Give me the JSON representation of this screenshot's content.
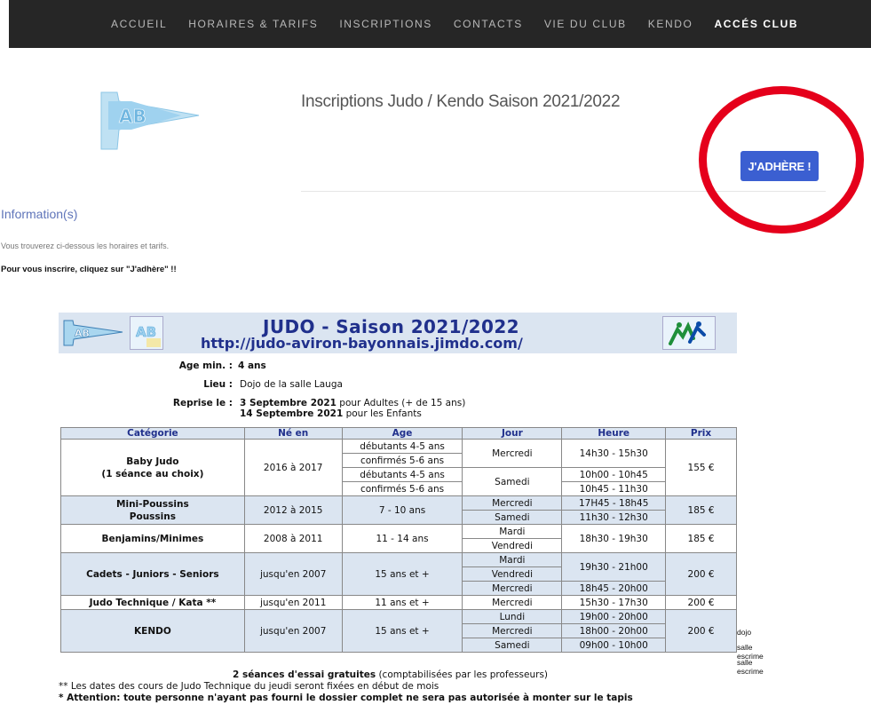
{
  "nav": {
    "items": [
      "ACCUEIL",
      "HORAIRES & TARIFS",
      "INSCRIPTIONS",
      "CONTACTS",
      "VIE DU CLUB",
      "KENDO",
      "ACCÉS CLUB"
    ],
    "active": "ACCÉS CLUB"
  },
  "logo": {
    "text": "AB"
  },
  "page_title": "Inscriptions Judo / Kendo Saison 2021/2022",
  "join_button": "J'ADHÈRE !",
  "info": {
    "heading": "Information(s)",
    "text": "Vous trouverez ci-dessous les horaires et tarifs.",
    "bold": "Pour vous inscrire, cliquez sur \"J'adhère\" !!"
  },
  "poster": {
    "title": "JUDO - Saison 2021/2022",
    "url": "http://judo-aviron-bayonnais.jimdo.com/",
    "age_label": "Age min. :",
    "age_value": "4 ans",
    "place_label": "Lieu :",
    "place_value": "Dojo de la salle Lauga",
    "resume_label": "Reprise le :",
    "resume_1_bold": "3 Septembre 2021",
    "resume_1_rest": " pour Adultes (+ de 15 ans)",
    "resume_2_bold": "14 Septembre 2021",
    "resume_2_rest": " pour les Enfants",
    "headers": [
      "Catégorie",
      "Né en",
      "Age",
      "Jour",
      "Heure",
      "Prix"
    ],
    "baby": {
      "cat1": "Baby Judo",
      "cat2": "(1 séance au choix)",
      "born": "2016 à 2017",
      "a1": "débutants 4-5 ans",
      "a2": "confirmés 5-6 ans",
      "a3": "débutants 4-5 ans",
      "a4": "confirmés 5-6 ans",
      "day1": "Mercredi",
      "day2": "Samedi",
      "h1": "14h30 - 15h30",
      "h2": "10h00 - 10h45",
      "h3": "10h45 - 11h30",
      "price": "155 €"
    },
    "mini": {
      "cat1": "Mini-Poussins",
      "cat2": "Poussins",
      "born": "2012 à 2015",
      "age": "7 - 10 ans",
      "day1": "Mercredi",
      "day2": "Samedi",
      "h1": "17H45 - 18h45",
      "h2": "11h30 - 12h30",
      "price": "185 €"
    },
    "benj": {
      "cat": "Benjamins/Minimes",
      "born": "2008 à 2011",
      "age": "11 - 14 ans",
      "day1": "Mardi",
      "day2": "Vendredi",
      "h": "18h30 - 19h30",
      "price": "185 €"
    },
    "cad": {
      "cat": "Cadets - Juniors - Seniors",
      "born": "jusqu'en 2007",
      "age": "15 ans et +",
      "day1": "Mardi",
      "day2": "Vendredi",
      "day3": "Mercredi",
      "h1": "19h30 - 21h00",
      "h2": "18h45 - 20h00",
      "price": "200 €"
    },
    "tech": {
      "cat": "Judo Technique / Kata **",
      "born": "jusqu'en 2011",
      "age": "11 ans et +",
      "day": "Mercredi",
      "h": "15h30 - 17h30",
      "price": "200 €"
    },
    "kendo": {
      "cat": "KENDO",
      "born": "jusqu'en 2007",
      "age": "15 ans et +",
      "day1": "Lundi",
      "day2": "Mercredi",
      "day3": "Samedi",
      "h1": "19h00 - 20h00",
      "h2": "18h00 - 20h00",
      "h3": "09h00 - 10h00",
      "price": "200 €",
      "v1": "dojo",
      "v2": "salle escrime",
      "v3": "salle escrime"
    },
    "foot1_bold": "2 séances d'essai gratuites",
    "foot1_rest": " (comptabilisées par les professeurs)",
    "foot2": "** Les dates des cours de Judo Technique du jeudi seront fixées en début de mois",
    "foot3": "* Attention: toute personne n'ayant pas fourni le dossier complet ne sera pas autorisée à monter sur le tapis"
  },
  "colors": {
    "nav_bg": "#262626",
    "button": "#3b5fd1",
    "highlight": "#e5001b",
    "table_shade": "#dbe5f1",
    "title_blue": "#20308c"
  }
}
